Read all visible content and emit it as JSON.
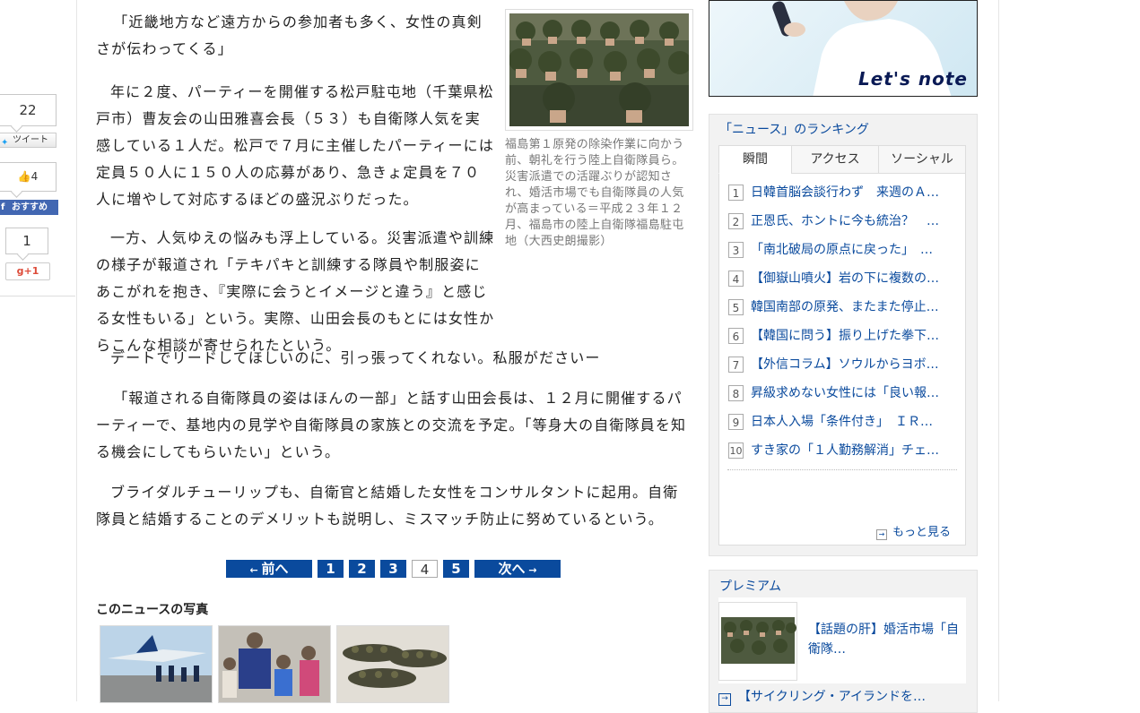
{
  "share": {
    "twitter_count": "22",
    "twitter_label": "ツイート",
    "fb_count": "4",
    "fb_label": "おすすめ",
    "gplus_count": "1",
    "gplus_label": "+1"
  },
  "article": {
    "paragraphs": [
      "「近畿地方など遠方からの参加者も多く、女性の真剣さが伝わってくる」",
      "年に２度、パーティーを開催する松戸駐屯地（千葉県松戸市）曹友会の山田雅喜会長（５３）も自衛隊人気を実感している１人だ。松戸で７月に主催したパーティーには定員５０人に１５０人の応募があり、急きょ定員を７０人に増やして対応するほどの盛況ぶりだった。",
      "一方、人気ゆえの悩みも浮上している。災害派遣や訓練の様子が報道され「テキパキと訓練する隊員や制服姿にあこがれを抱き、『実際に会うとイメージと違う』と感じる女性もいる」という。実際、山田会長のもとには女性からこんな相談が寄せられたという。",
      "デートでリードしてほしいのに、引っ張ってくれない。私服がださいー",
      "「報道される自衛隊員の姿はほんの一部」と話す山田会長は、１２月に開催するパーティーで、基地内の見学や自衛隊員の家族との交流を予定。「等身大の自衛隊員を知る機会にしてもらいたい」という。",
      "ブライダルチューリップも、自衛官と結婚した女性をコンサルタントに起用。自衛隊員と結婚することのデメリットも説明し、ミスマッチ防止に努めているという。"
    ],
    "photo_caption": "福島第１原発の除染作業に向かう前、朝礼を行う陸上自衛隊員ら。災害派遣での活躍ぶりが認知され、婚活市場でも自衛隊員の人気が高まっている＝平成２３年１２月、福島市の陸上自衛隊福島駐屯地（大西史朗撮影）"
  },
  "pagination": {
    "prev": "前へ",
    "next": "次へ",
    "pages": [
      "1",
      "2",
      "3",
      "4",
      "5"
    ],
    "current": "4"
  },
  "photos_section": {
    "title": "このニュースの写真"
  },
  "ranking": {
    "title": "「ニュース」のランキング",
    "tabs": [
      "瞬間",
      "アクセス",
      "ソーシャル"
    ],
    "items": [
      {
        "num": "1",
        "text": "日韓首脳会談行わず　来週のＡ…"
      },
      {
        "num": "2",
        "text": "正恩氏、ホントに今も統治？　…"
      },
      {
        "num": "3",
        "text": "「南北破局の原点に戻った」　…"
      },
      {
        "num": "4",
        "text": "【御嶽山噴火】岩の下に複数の…"
      },
      {
        "num": "5",
        "text": "韓国南部の原発、またまた停止…"
      },
      {
        "num": "6",
        "text": "【韓国に問う】振り上げた拳下…"
      },
      {
        "num": "7",
        "text": "【外信コラム】ソウルからヨボ…"
      },
      {
        "num": "8",
        "text": "昇級求めない女性には「良い報…"
      },
      {
        "num": "9",
        "text": "日本人入場「条件付き」　ＩＲ…"
      },
      {
        "num": "10",
        "text": "すき家の「１人勤務解消」チェ…"
      }
    ],
    "more": "もっと見る"
  },
  "ad": {
    "logo": "Let's note"
  },
  "premium": {
    "title": "プレミアム",
    "item_text": "【話題の肝】婚活市場「自衛隊…",
    "link_text": "【サイクリング・アイランドを…"
  },
  "colors": {
    "accent_blue": "#0a4a9d",
    "facebook": "#4267b2",
    "twitter": "#1da1f2",
    "gplus": "#dd4b39"
  }
}
